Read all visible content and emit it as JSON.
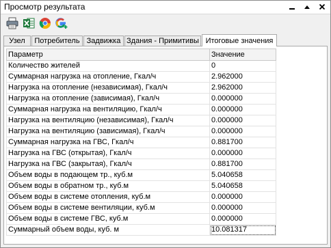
{
  "window": {
    "title": "Просмотр результата",
    "controls": {
      "minimize": "▬",
      "restore": "▲",
      "close": "✕"
    }
  },
  "toolbar": {
    "icons": [
      "printer-icon",
      "excel-icon",
      "chrome-icon",
      "google-plus-icon"
    ]
  },
  "tabs": [
    {
      "label": "Узел",
      "active": false
    },
    {
      "label": "Потребитель",
      "active": false
    },
    {
      "label": "Задвижка",
      "active": false
    },
    {
      "label": "Здания - Примитивы",
      "active": false
    },
    {
      "label": "Итоговые значения",
      "active": true
    }
  ],
  "table": {
    "headers": {
      "param": "Параметр",
      "value": "Значение"
    },
    "rows": [
      {
        "param": "Количество жителей",
        "value": "0"
      },
      {
        "param": "Суммарная нагрузка на отопление, Гкал/ч",
        "value": "2.962000"
      },
      {
        "param": "Нагрузка на отопление (независимая), Гкал/ч",
        "value": "2.962000"
      },
      {
        "param": "Нагрузка на отопление (зависимая), Гкал/ч",
        "value": "0.000000"
      },
      {
        "param": "Суммарная нагрузка на вентиляцию, Гкал/ч",
        "value": "0.000000"
      },
      {
        "param": "Нагрузка на вентиляцию (независимая), Гкал/ч",
        "value": "0.000000"
      },
      {
        "param": "Нагрузка на вентиляцию (зависимая), Гкал/ч",
        "value": "0.000000"
      },
      {
        "param": "Суммарная нагрузка на ГВС, Гкал/ч",
        "value": "0.881700"
      },
      {
        "param": "Нагрузка на ГВС (открытая), Гкал/ч",
        "value": "0.000000"
      },
      {
        "param": "Нагрузка на ГВС (закрытая), Гкал/ч",
        "value": "0.881700"
      },
      {
        "param": "Объем воды в подающем тр., куб.м",
        "value": "5.040658"
      },
      {
        "param": "Объем воды в обратном тр., куб.м",
        "value": "5.040658"
      },
      {
        "param": "Объем воды в системе отопления, куб.м",
        "value": "0.000000"
      },
      {
        "param": "Объем воды в системе вентиляции, куб.м",
        "value": "0.000000"
      },
      {
        "param": "Объем воды в системе ГВС, куб.м",
        "value": "0.000000"
      },
      {
        "param": "Суммарный объем воды, куб. м",
        "value": "10.081317"
      }
    ]
  },
  "colors": {
    "excel_green": "#1f7a3c",
    "google_blue": "#4285f4",
    "google_red": "#db4437",
    "google_yellow": "#f4b400",
    "google_green": "#0f9d58"
  }
}
